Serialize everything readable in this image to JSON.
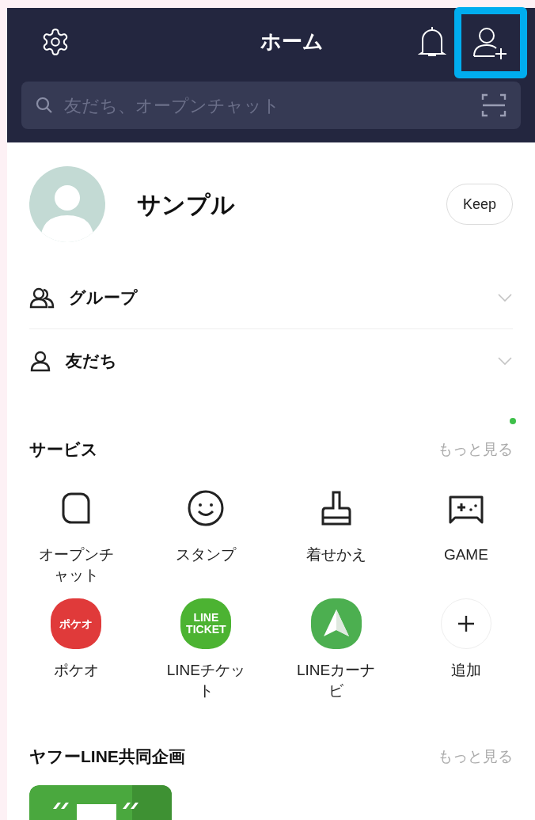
{
  "header": {
    "title": "ホーム",
    "add_friend_highlighted": true
  },
  "search": {
    "placeholder": "友だち、オープンチャット"
  },
  "profile": {
    "name": "サンプル",
    "keep_button": "Keep"
  },
  "sections": [
    {
      "kind": "group",
      "label": "グループ",
      "expanded": false
    },
    {
      "kind": "friend",
      "label": "友だち",
      "expanded": false
    }
  ],
  "services": {
    "title": "サービス",
    "more": "もっと見る",
    "has_new": true,
    "items": [
      {
        "kind": "open-chat",
        "label": "オープンチャット"
      },
      {
        "kind": "sticker",
        "label": "スタンプ"
      },
      {
        "kind": "theme",
        "label": "着せかえ"
      },
      {
        "kind": "game",
        "label": "GAME"
      },
      {
        "kind": "app",
        "label": "ポケオ",
        "icon_text": "ポケオ",
        "color": "#e03a3a"
      },
      {
        "kind": "app",
        "label": "LINEチケット",
        "icon_text": "LINE TICKET",
        "color": "#4cb332"
      },
      {
        "kind": "navi",
        "label": "LINEカーナビ",
        "color": "#4caf50"
      },
      {
        "kind": "add",
        "label": "追加"
      }
    ]
  },
  "collab": {
    "title": "ヤフーLINE共同企画",
    "more": "もっと見る"
  }
}
